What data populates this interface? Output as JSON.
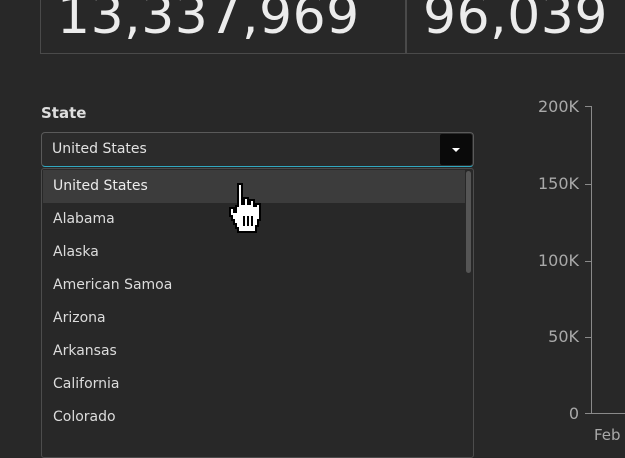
{
  "stats": {
    "cases_value": "13,337,969",
    "deaths_value": "96,039"
  },
  "state_filter": {
    "label": "State",
    "selected": "United States",
    "options": [
      "United States",
      "Alabama",
      "Alaska",
      "American Samoa",
      "Arizona",
      "Arkansas",
      "California",
      "Colorado"
    ]
  },
  "chart": {
    "y_ticks": [
      "200K",
      "150K",
      "100K",
      "50K",
      "0"
    ],
    "x_ticks": [
      "Feb"
    ]
  },
  "colors": {
    "background": "#282828",
    "focus_accent": "#31a9c1",
    "hover_row": "#3c3c3c"
  },
  "icons": {
    "dropdown_caret": "caret-down-icon",
    "pointer": "hand-pointer-icon"
  }
}
